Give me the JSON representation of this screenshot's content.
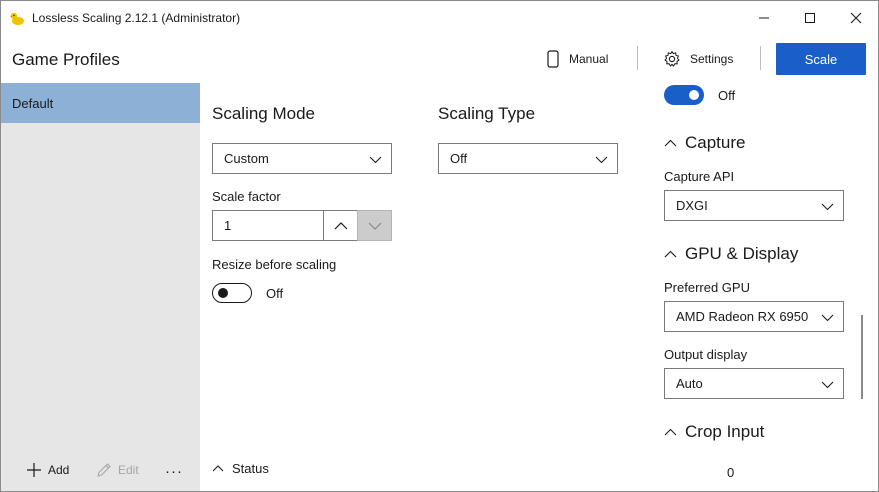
{
  "window": {
    "title": "Lossless Scaling 2.12.1 (Administrator)",
    "icon": "duck-icon",
    "controls": [
      "minimize-icon",
      "maximize-icon",
      "close-icon"
    ]
  },
  "header": {
    "title": "Game Profiles",
    "manual_label": "Manual",
    "settings_label": "Settings",
    "scale_label": "Scale"
  },
  "sidebar": {
    "profiles": [
      {
        "label": "Default",
        "selected": true
      }
    ],
    "add_label": "Add",
    "edit_label": "Edit",
    "more_label": "···"
  },
  "main": {
    "scaling_mode": {
      "heading": "Scaling Mode",
      "value": "Custom"
    },
    "scaling_type": {
      "heading": "Scaling Type",
      "value": "Off"
    },
    "scale_factor": {
      "label": "Scale factor",
      "value": "1"
    },
    "resize_before_scaling": {
      "label": "Resize before scaling",
      "state": "Off"
    },
    "status_label": "Status"
  },
  "right_panel": {
    "top_toggle_state": "Off",
    "capture": {
      "heading": "Capture",
      "api_label": "Capture API",
      "api_value": "DXGI"
    },
    "gpu_display": {
      "heading": "GPU & Display",
      "gpu_label": "Preferred GPU",
      "gpu_value": "AMD Radeon RX 6950",
      "output_label": "Output display",
      "output_value": "Auto"
    },
    "crop_input": {
      "heading": "Crop Input",
      "value": "0"
    }
  },
  "colors": {
    "accent": "#1a5fc9",
    "sidebar_bg": "#e6e6e6",
    "selected_profile": "#8db0d6"
  }
}
